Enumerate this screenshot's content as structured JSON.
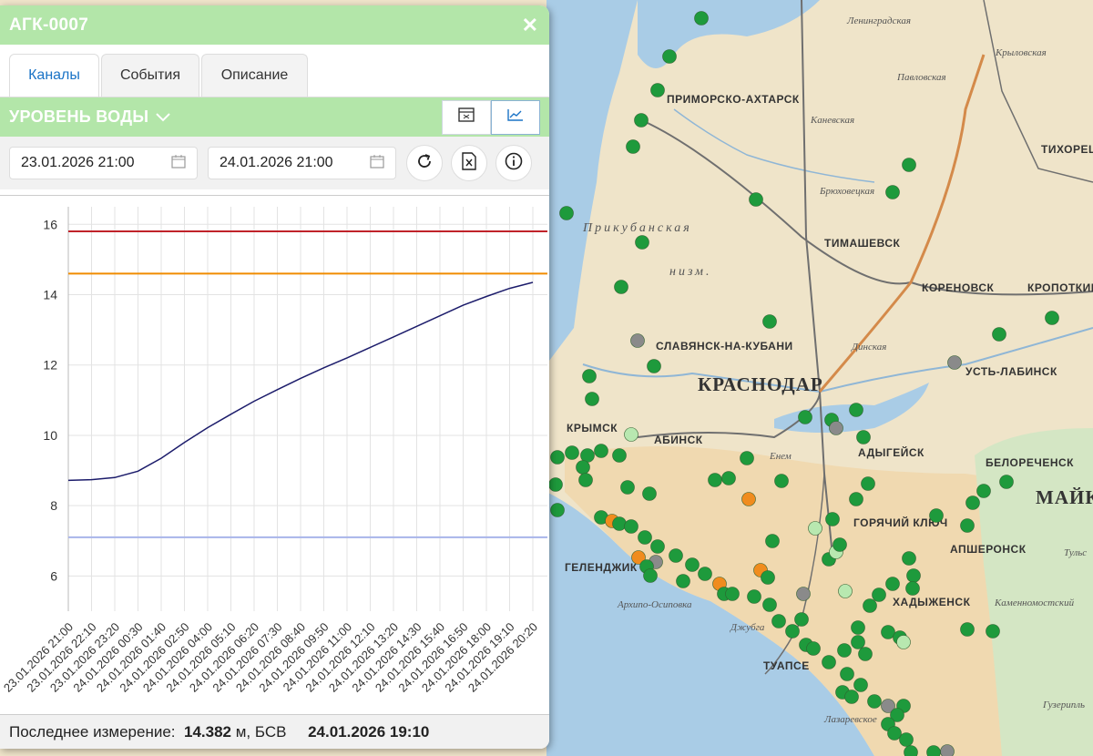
{
  "window": {
    "title": "АГК-0007",
    "close_icon": "close-icon"
  },
  "tabs": [
    {
      "label": "Каналы",
      "active": true
    },
    {
      "label": "События",
      "active": false
    },
    {
      "label": "Описание",
      "active": false
    }
  ],
  "channel": {
    "label": "УРОВЕНЬ ВОДЫ",
    "dropdown_icon": "chevron-down-icon"
  },
  "view_toggle": [
    {
      "icon": "table-icon",
      "selected": false
    },
    {
      "icon": "line-chart-icon",
      "selected": true
    }
  ],
  "filters": {
    "date_from": "23.01.2026 21:00",
    "date_to": "24.01.2026 21:00",
    "calendar_icon": "calendar-icon",
    "refresh_icon": "refresh-icon",
    "excel_icon": "excel-export-icon",
    "info_icon": "info-icon"
  },
  "status": {
    "label": "Последнее измерение:",
    "value": "14.382",
    "unit": "м, БСВ",
    "datetime": "24.01.2026 19:10"
  },
  "chart_data": {
    "type": "line",
    "x": [
      "23.01.2026 21:00",
      "23.01.2026 22:10",
      "23.01.2026 23:20",
      "24.01.2026 00:30",
      "24.01.2026 01:40",
      "24.01.2026 02:50",
      "24.01.2026 04:00",
      "24.01.2026 05:10",
      "24.01.2026 06:20",
      "24.01.2026 07:30",
      "24.01.2026 08:40",
      "24.01.2026 09:50",
      "24.01.2026 11:00",
      "24.01.2026 12:10",
      "24.01.2026 13:20",
      "24.01.2026 14:30",
      "24.01.2026 15:40",
      "24.01.2026 16:50",
      "24.01.2026 18:00",
      "24.01.2026 19:10",
      "24.01.2026 20:20"
    ],
    "series": [
      {
        "values": [
          8.72,
          8.74,
          8.8,
          8.98,
          9.35,
          9.8,
          10.22,
          10.6,
          10.97,
          11.3,
          11.62,
          11.92,
          12.2,
          12.5,
          12.8,
          13.1,
          13.4,
          13.7,
          13.95,
          14.18,
          14.35
        ],
        "color": "#1c1c6b"
      }
    ],
    "thresholds": [
      {
        "value": 15.8,
        "color": "#c0232a"
      },
      {
        "value": 14.6,
        "color": "#f08c00"
      },
      {
        "value": 7.1,
        "color": "#a8b4ea"
      }
    ],
    "ylim": [
      5,
      16.5
    ],
    "yticks": [
      6,
      8,
      10,
      12,
      14,
      16
    ],
    "grid": true,
    "xlabel": "",
    "ylabel": "",
    "title": ""
  },
  "map": {
    "cities": [
      "ПРИМОРСКО-АХТАРСК",
      "ТИХОРЕЦК",
      "ТИМАШЕВСК",
      "КОРЕНОВСК",
      "КРОПОТКИН",
      "СЛАВЯНСК-НА-КУБАНИ",
      "КРАСНОДАР",
      "УСТЬ-ЛАБИНСК",
      "КРЫМСК",
      "АБИНСК",
      "АДЫГЕЙСК",
      "БЕЛОРЕЧЕНСК",
      "ГОРЯЧИЙ КЛЮЧ",
      "АПШЕРОНСК",
      "ГЕЛЕНДЖИК",
      "ХАДЫЖЕНСК",
      "ТУАПСЕ",
      "МАЙК"
    ],
    "places": [
      "Ленинградская",
      "Крыловская",
      "Павловская",
      "Каневская",
      "Брюховецкая",
      "Динская",
      "Енем",
      "Джубга",
      "Архипо-Осиповка",
      "Каменномостский",
      "Тульс",
      "Гузерипль",
      "Лазаревское"
    ],
    "regions": [
      "Прикубанская",
      "низм."
    ],
    "status_colors": {
      "normal": "#1e9a3c",
      "warning": "#f08c1e",
      "offline": "#8a8a8a",
      "inactive": "#b8e8b0"
    }
  }
}
